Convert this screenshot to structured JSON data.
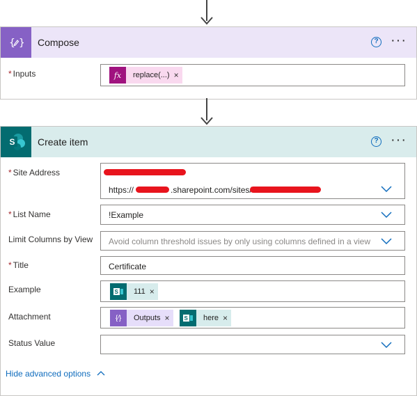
{
  "compose": {
    "title": "Compose",
    "help_glyph": "?",
    "more_glyph": "···",
    "inputs_label": "Inputs",
    "inputs_token": {
      "label": "replace(...)",
      "icon": "fx",
      "remove": "×"
    }
  },
  "create_item": {
    "title": "Create item",
    "help_glyph": "?",
    "more_glyph": "···",
    "site_address": {
      "label": "Site Address",
      "url_prefix": "https://",
      "url_mid": ".sharepoint.com/sites/"
    },
    "list_name": {
      "label": "List Name",
      "value": "!Example"
    },
    "limit_columns": {
      "label": "Limit Columns by View",
      "placeholder": "Avoid column threshold issues by only using columns defined in a view"
    },
    "title_field": {
      "label": "Title",
      "value": "Certificate"
    },
    "example": {
      "label": "Example",
      "token": {
        "label": "111",
        "remove": "×"
      }
    },
    "attachment": {
      "label": "Attachment",
      "tokens": [
        {
          "label": "Outputs",
          "remove": "×"
        },
        {
          "label": "here",
          "remove": "×"
        }
      ]
    },
    "status_value": {
      "label": "Status Value",
      "value": ""
    },
    "hide_advanced": "Hide advanced options",
    "required_mark": "*"
  },
  "colors": {
    "compose_accent": "#8661c5",
    "compose_header": "#ece5f8",
    "sharepoint_accent": "#036c70",
    "create_header": "#d9ecec",
    "link": "#0f6cbd"
  }
}
